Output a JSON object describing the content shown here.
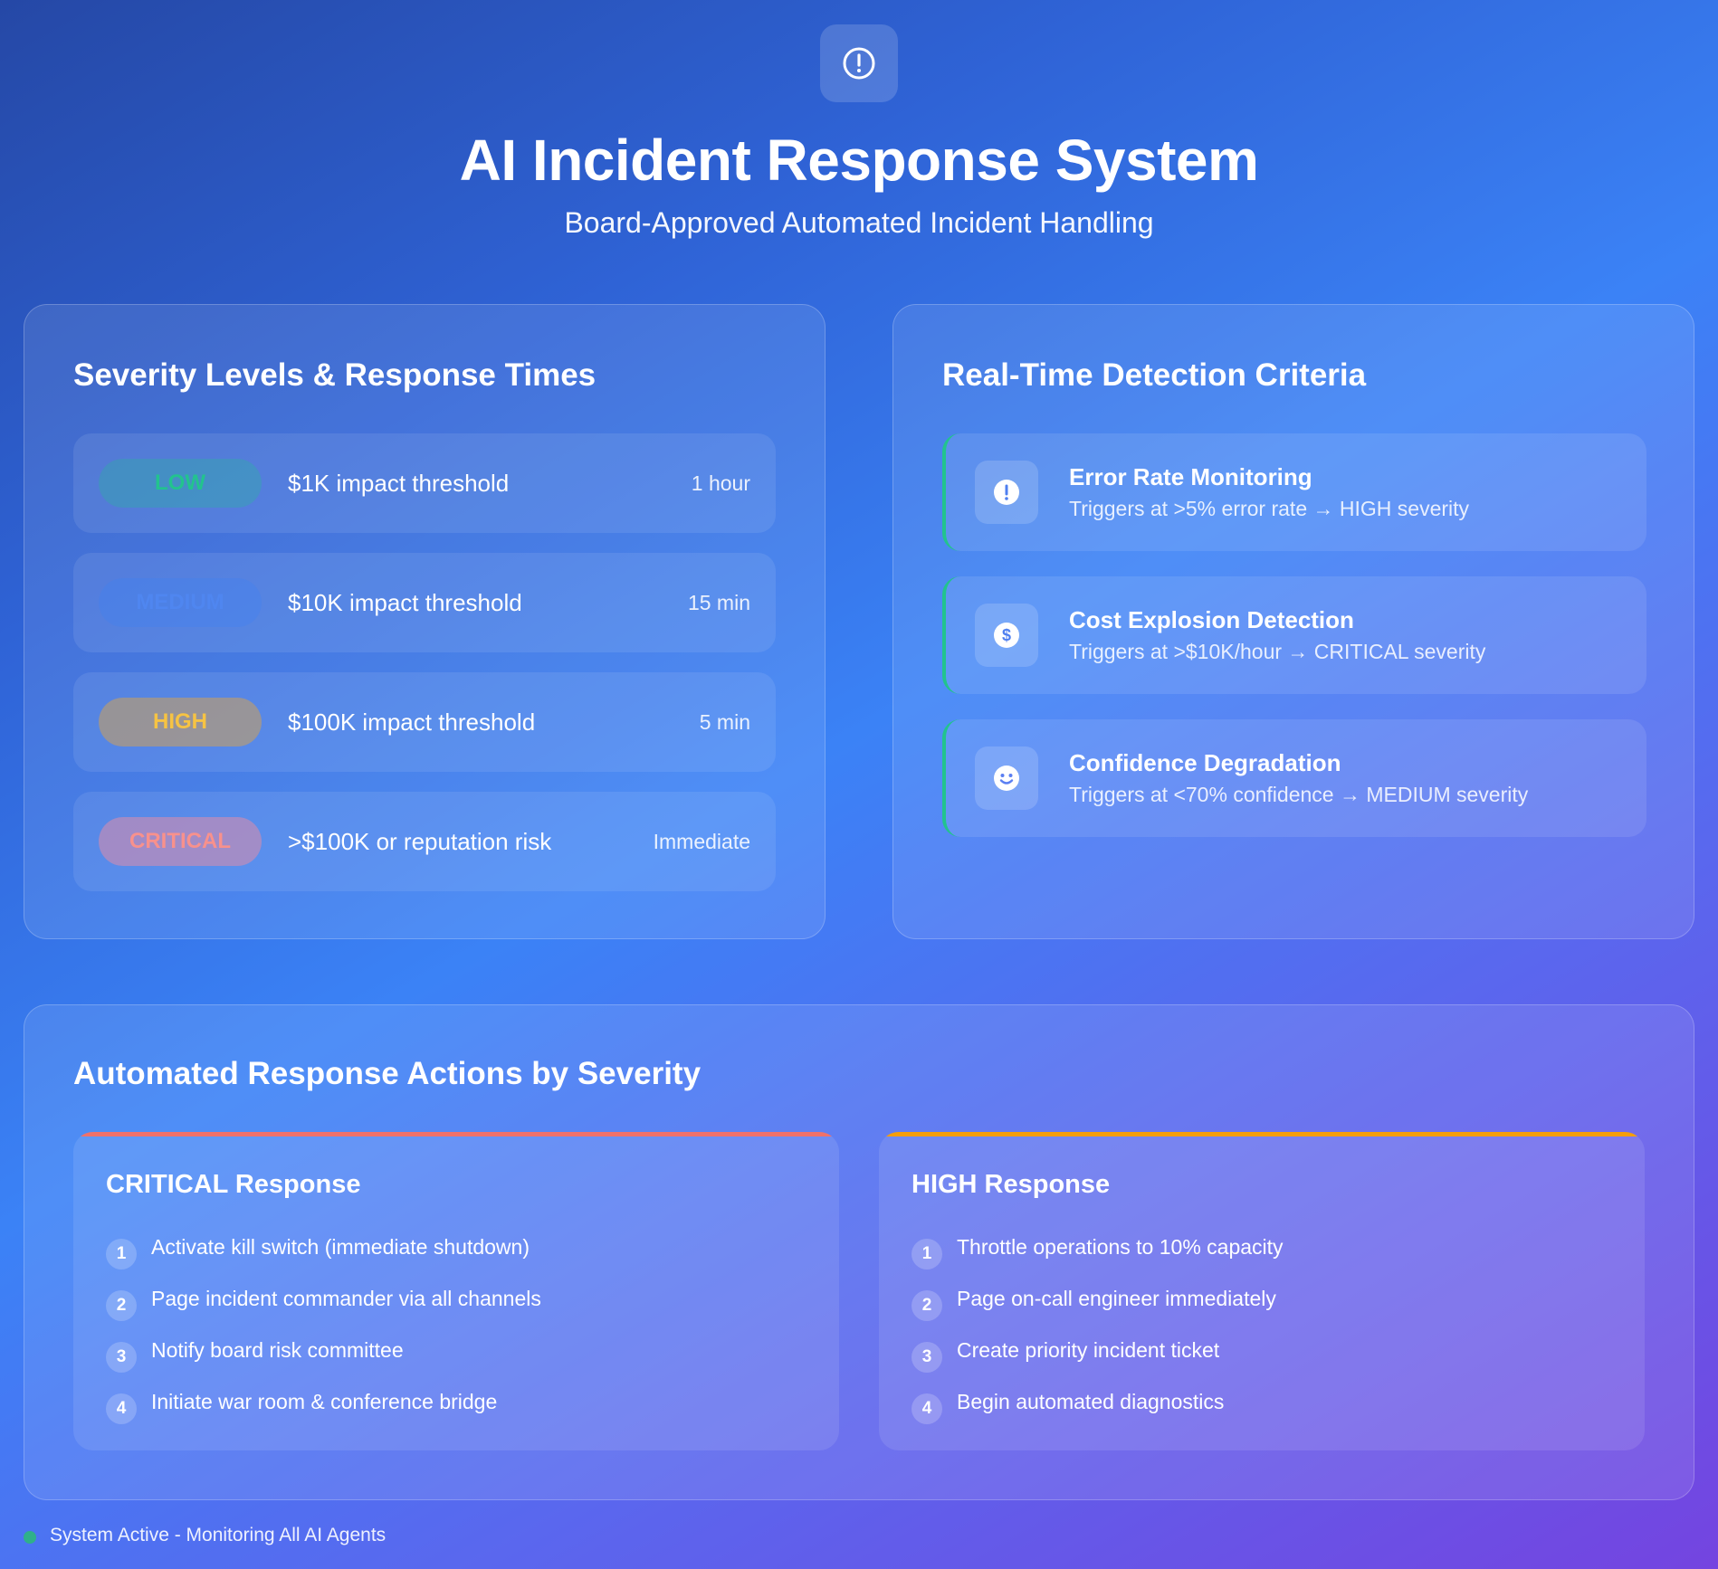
{
  "header": {
    "icon": "alert-circle-icon",
    "title": "AI Incident Response System",
    "subtitle": "Board-Approved Automated Incident Handling"
  },
  "severity_panel": {
    "title": "Severity Levels & Response Times",
    "levels": [
      {
        "label": "LOW",
        "description": "$1K impact threshold",
        "time": "1 hour",
        "color": "#22c38e"
      },
      {
        "label": "MEDIUM",
        "description": "$10K impact threshold",
        "time": "15 min",
        "color": "#4f86f0"
      },
      {
        "label": "HIGH",
        "description": "$100K impact threshold",
        "time": "5 min",
        "color": "#f6c343"
      },
      {
        "label": "CRITICAL",
        "description": ">$100K or reputation risk",
        "time": "Immediate",
        "color": "#f8918c"
      }
    ]
  },
  "detection_panel": {
    "title": "Real-Time Detection Criteria",
    "criteria": [
      {
        "icon": "alert-icon",
        "title": "Error Rate Monitoring",
        "text": "Triggers at >5% error rate → HIGH severity"
      },
      {
        "icon": "dollar-icon",
        "title": "Cost Explosion Detection",
        "text": "Triggers at >$10K/hour → CRITICAL severity"
      },
      {
        "icon": "smiley-icon",
        "title": "Confidence Degradation",
        "text": "Triggers at <70% confidence → MEDIUM severity"
      }
    ]
  },
  "actions_panel": {
    "title": "Automated Response Actions by Severity",
    "critical": {
      "title": "CRITICAL Response",
      "accent": "#f0716a",
      "steps": [
        {
          "num": "1",
          "text": "Activate kill switch (immediate shutdown)"
        },
        {
          "num": "2",
          "text": "Page incident commander via all channels"
        },
        {
          "num": "3",
          "text": "Notify board risk committee"
        },
        {
          "num": "4",
          "text": "Initiate war room & conference bridge"
        }
      ]
    },
    "high": {
      "title": "HIGH Response",
      "accent": "#f59e0b",
      "steps": [
        {
          "num": "1",
          "text": "Throttle operations to 10% capacity"
        },
        {
          "num": "2",
          "text": "Page on-call engineer immediately"
        },
        {
          "num": "3",
          "text": "Create priority incident ticket"
        },
        {
          "num": "4",
          "text": "Begin automated diagnostics"
        }
      ]
    }
  },
  "status": {
    "text": "System Active - Monitoring All AI Agents",
    "color": "#2fb08a"
  }
}
